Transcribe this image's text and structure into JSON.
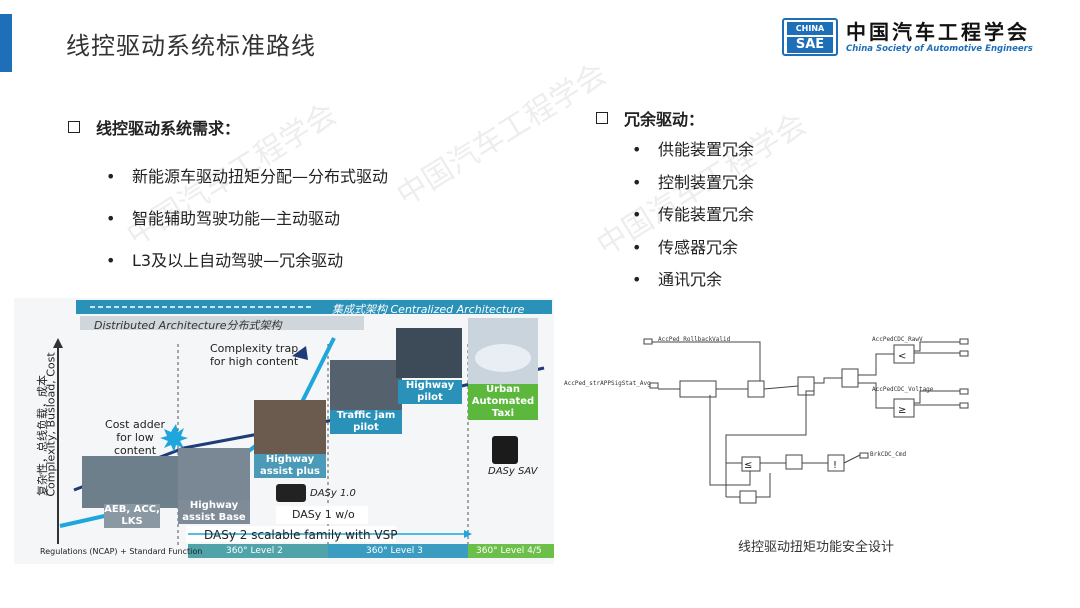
{
  "header": {
    "title": "线控驱动系统标准路线",
    "logo": {
      "badge_top": "CHINA",
      "badge_bottom": "SAE",
      "name_cn": "中国汽车工程学会",
      "name_en": "China Society of Automotive Engineers"
    }
  },
  "watermark": "中国汽车工程学会",
  "requirements": {
    "heading": "线控驱动系统需求：",
    "items": [
      "新能源车驱动扭矩分配—分布式驱动",
      "智能辅助驾驶功能—主动驱动",
      "L3及以上自动驾驶—冗余驱动"
    ]
  },
  "redundancy": {
    "heading": "冗余驱动：",
    "items": [
      "供能装置冗余",
      "控制装置冗余",
      "传能装置冗余",
      "传感器冗余",
      "通讯冗余"
    ]
  },
  "roadmap": {
    "centralized": "集成式架构 Centralized Architecture",
    "distributed": "Distributed Architecture分布式架构",
    "ylabel_cn": "复杂性，总线负载，成本",
    "ylabel_en": "Complexity, Busload, Cost",
    "complexity_trap": "Complexity trap for high content",
    "cost_adder": "Cost adder for low content",
    "stages": [
      "AEB, ACC, LKS",
      "Highway assist Base",
      "Highway assist plus",
      "Traffic jam pilot",
      "Highway pilot",
      "Urban Automated Taxi"
    ],
    "dasy_10": "DASy 1.0",
    "dasy_1wo": "DASy 1 w/o",
    "dasy_sav": "DASy SAV",
    "family": "DASy 2 scalable family with VSP",
    "regulations": "Regulations (NCAP) + Standard Function",
    "levels": [
      "360° Level 2",
      "360° Level 3",
      "360° Level 4/5"
    ]
  },
  "diagram": {
    "caption": "线控驱动扭矩功能安全设计"
  }
}
